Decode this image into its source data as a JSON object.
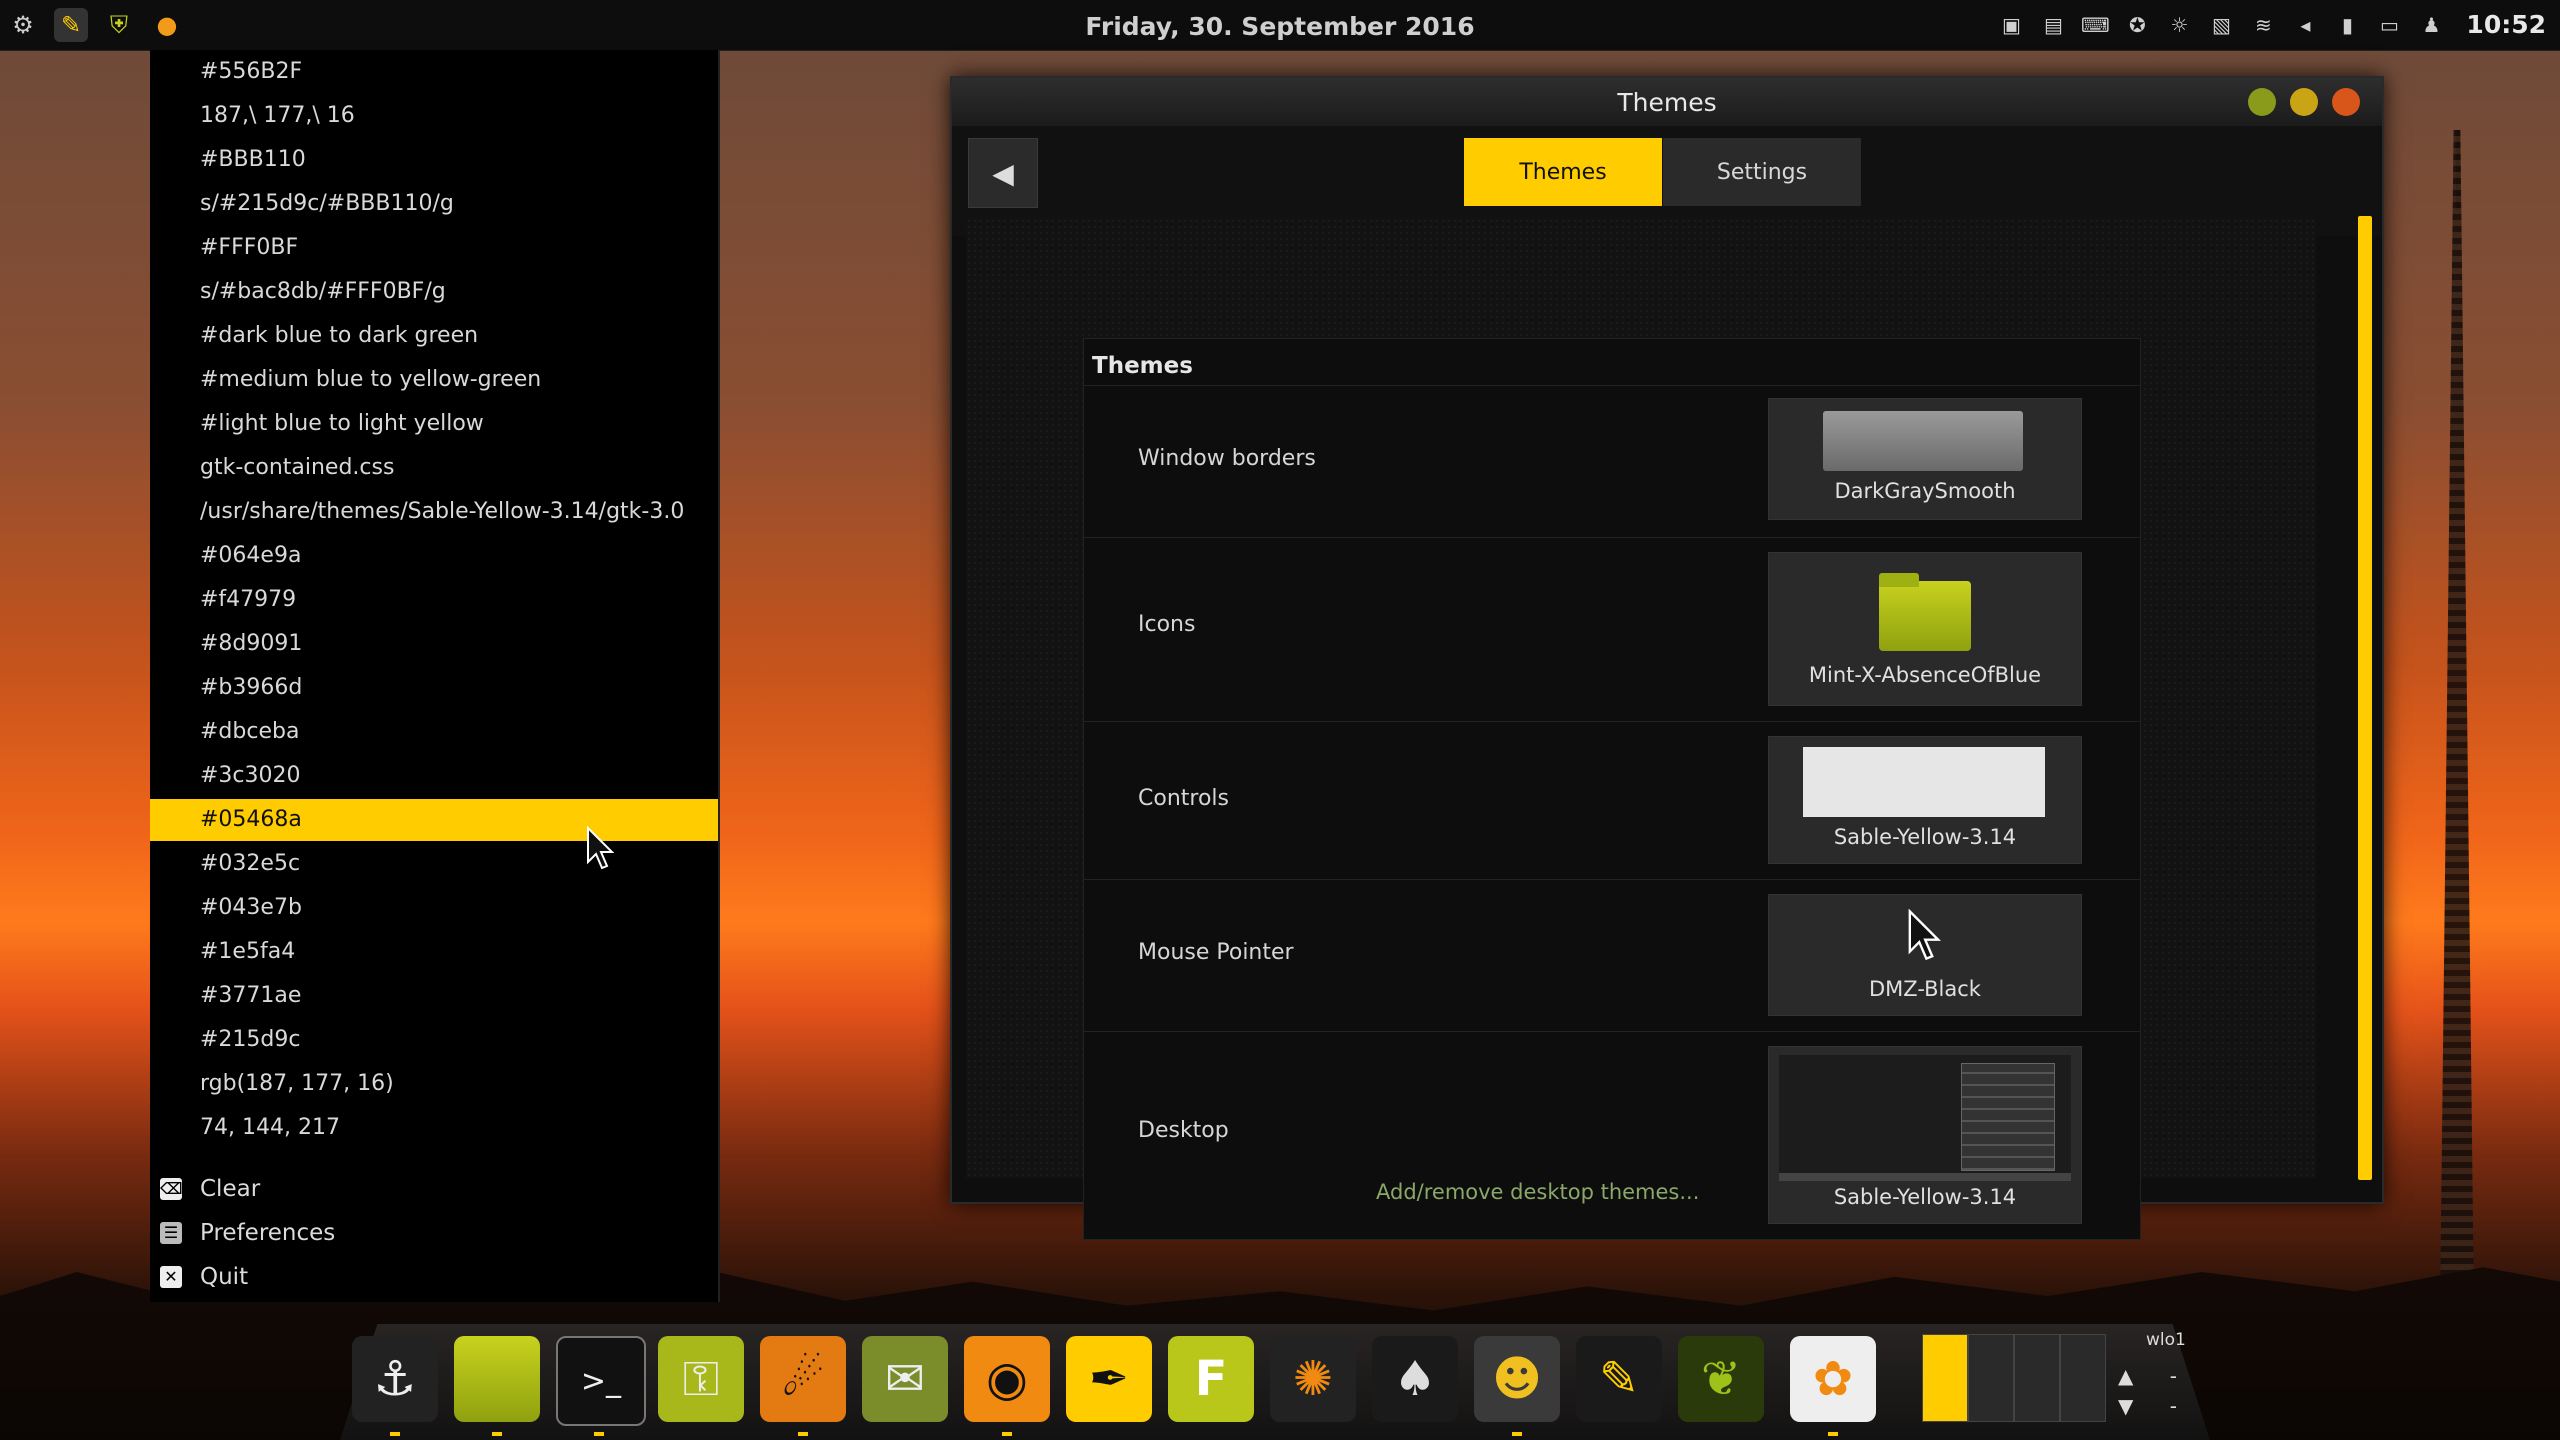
{
  "panel": {
    "date": "Friday, 30. September 2016",
    "time": "10:52",
    "left_icons": [
      "gear-icon",
      "pencil-icon",
      "shield-icon",
      "bird-icon"
    ],
    "tray_icons": [
      "display-icon",
      "document-icon",
      "keyboard-icon",
      "accessibility-icon",
      "brightness-icon",
      "clipboard-icon",
      "wifi-icon",
      "volume-icon",
      "battery-icon",
      "monitor-icon",
      "user-icon"
    ]
  },
  "clipboard": {
    "items": [
      "#556B2F",
      "187,\\ 177,\\ 16",
      "#BBB110",
      "s/#215d9c/#BBB110/g",
      "#FFF0BF",
      "s/#bac8db/#FFF0BF/g",
      "#dark blue to dark green",
      "#medium blue to yellow-green",
      "#light blue to light yellow",
      "gtk-contained.css",
      "/usr/share/themes/Sable-Yellow-3.14/gtk-3.0",
      "#064e9a",
      "#f47979",
      "#8d9091",
      "#b3966d",
      "#dbceba",
      "#3c3020",
      "#05468a",
      "#032e5c",
      "#043e7b",
      "#1e5fa4",
      "#3771ae",
      "#215d9c",
      "rgb(187, 177, 16)",
      "74, 144, 217"
    ],
    "selected_index": 17,
    "actions": {
      "clear": "Clear",
      "preferences": "Preferences",
      "quit": "Quit"
    }
  },
  "themes_window": {
    "title": "Themes",
    "tabs": {
      "themes": "Themes",
      "settings": "Settings"
    },
    "section_title": "Themes",
    "rows": {
      "window_borders": {
        "label": "Window borders",
        "value": "DarkGraySmooth"
      },
      "icons": {
        "label": "Icons",
        "value": "Mint-X-AbsenceOfBlue"
      },
      "controls": {
        "label": "Controls",
        "value": "Sable-Yellow-3.14"
      },
      "mouse_pointer": {
        "label": "Mouse Pointer",
        "value": "DMZ-Black"
      },
      "desktop": {
        "label": "Desktop",
        "value": "Sable-Yellow-3.14",
        "link": "Add/remove desktop themes..."
      }
    },
    "colors": {
      "accent": "#ffcc00",
      "minimize": "#8a9a1a",
      "maximize": "#c9a515",
      "close": "#d8561a"
    }
  },
  "dock": {
    "icons": [
      "anchor-icon",
      "folder-icon",
      "terminal-icon",
      "key-icon",
      "firefox-icon",
      "stamp-icon",
      "chrome-icon",
      "pen-icon",
      "f-icon",
      "aperture-icon",
      "inkscape-icon",
      "gimp-icon",
      "eyedropper-icon",
      "cannabis-icon",
      "photos-icon"
    ],
    "network_label": "wlo1",
    "net_up": "-",
    "net_down": "-"
  }
}
